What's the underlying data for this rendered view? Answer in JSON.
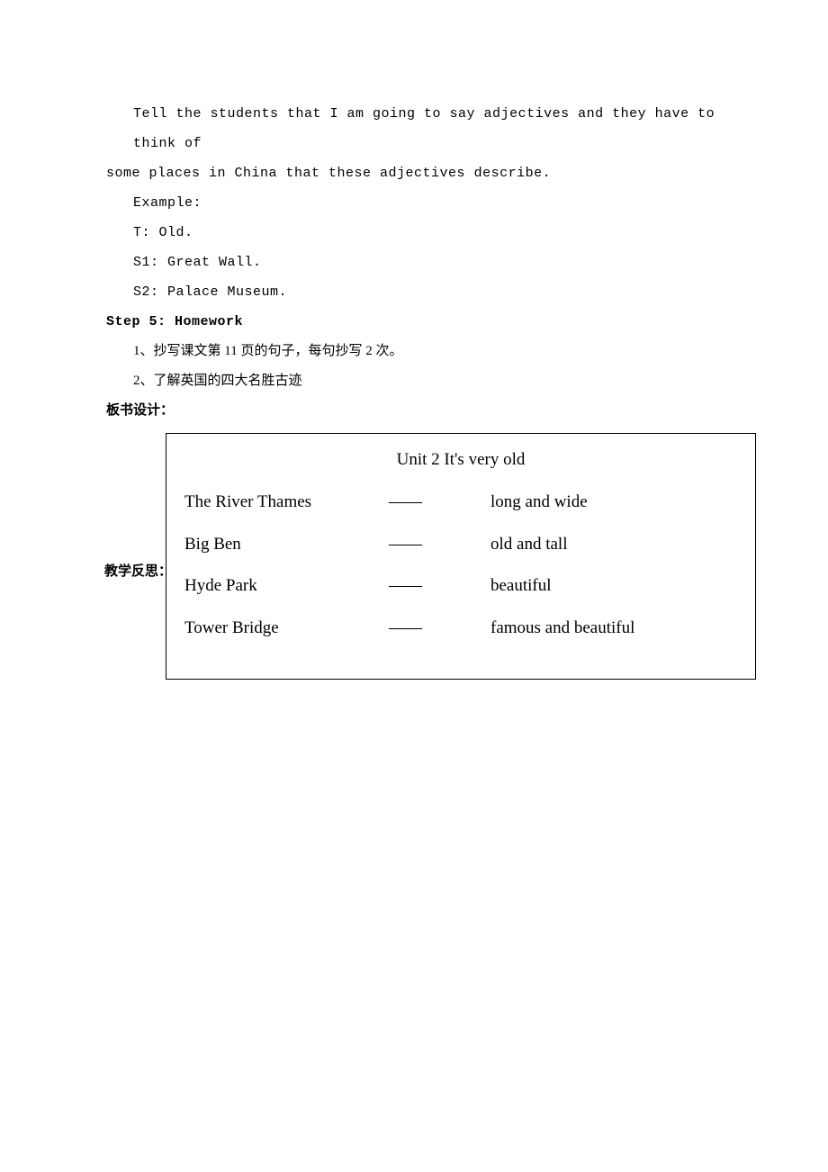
{
  "body": {
    "para1": "Tell the students that I am going to say adjectives and they have to think of",
    "para2": "some places in China that these adjectives describe.",
    "example_label": "Example:",
    "t_line": "T: Old.",
    "s1_line": "S1: Great Wall.",
    "s2_line": "S2: Palace Museum."
  },
  "step5": {
    "heading": "Step 5: Homework",
    "item1": "1、抄写课文第 11 页的句子，每句抄写 2 次。",
    "item2": "2、了解英国的四大名胜古迹"
  },
  "board_design_label": "板书设计：",
  "reflect_label": "教学反思：",
  "board": {
    "title": "Unit 2 It's very old",
    "dash": "——",
    "rows": [
      {
        "left": "The River Thames",
        "right": "long and wide"
      },
      {
        "left": "Big Ben",
        "right": "old and tall"
      },
      {
        "left": "Hyde Park",
        "right": "beautiful"
      },
      {
        "left": "Tower Bridge",
        "right": "famous and beautiful"
      }
    ]
  }
}
